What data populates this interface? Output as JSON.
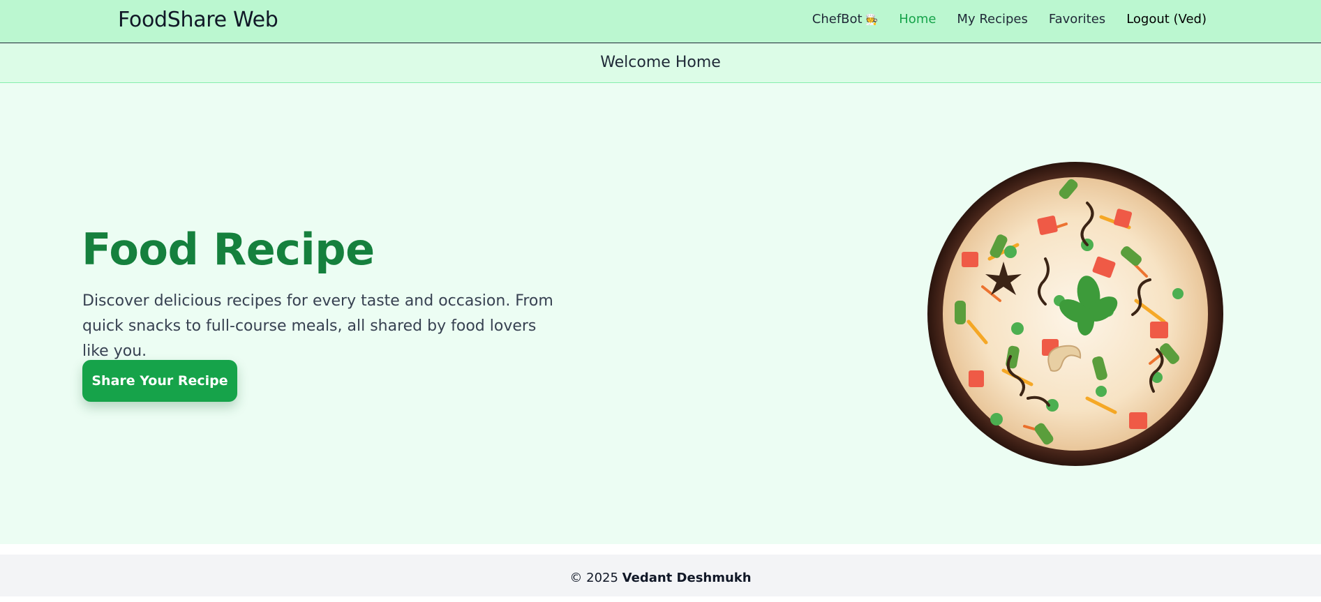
{
  "nav": {
    "brand": "FoodShare Web",
    "links": [
      {
        "label": "ChefBot",
        "icon": "chef-icon"
      },
      {
        "label": "Home",
        "active": true
      },
      {
        "label": "My Recipes"
      },
      {
        "label": "Favorites"
      },
      {
        "label": "Logout (Ved)"
      }
    ]
  },
  "subheader": {
    "title": "Welcome Home"
  },
  "hero": {
    "title": "Food Recipe",
    "description": "Discover delicious recipes for every taste and occasion. From quick snacks to full-course meals, all shared by food lovers like you.",
    "cta_label": "Share Your Recipe",
    "image": "biryani-bowl"
  },
  "footer": {
    "copyright": "© 2025",
    "author": "Vedant Deshmukh"
  },
  "colors": {
    "nav_bg": "#bbf7d0",
    "subheader_bg": "#dcfce7",
    "hero_bg": "#ecfdf3",
    "accent": "#16a34a",
    "title": "#15803d",
    "footer_bg": "#f3f4f6"
  }
}
